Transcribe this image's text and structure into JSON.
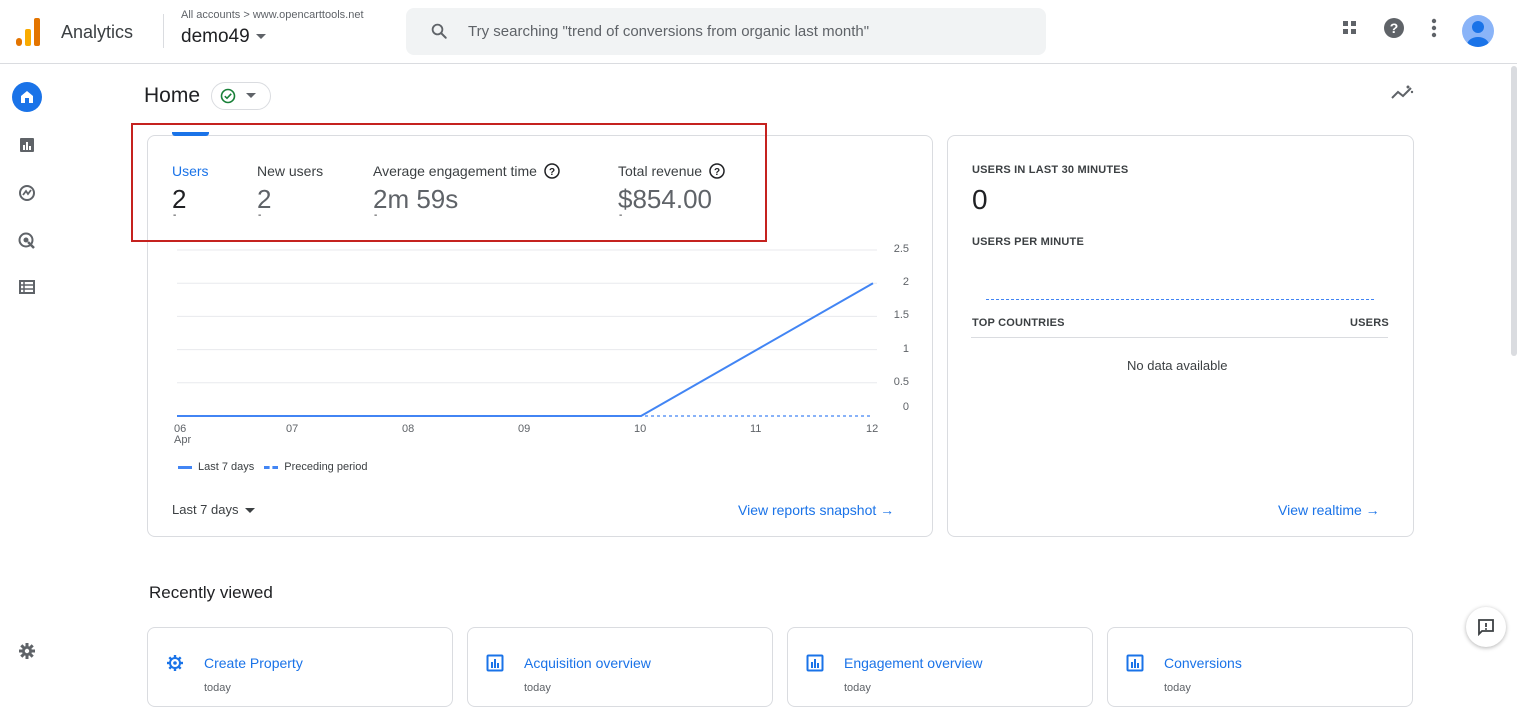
{
  "header": {
    "app_name": "Analytics",
    "breadcrumb": "All accounts > www.opencarttools.net",
    "account_name": "demo49",
    "search_placeholder": "Try searching \"trend of conversions from organic last month\""
  },
  "colors": {
    "accent": "#1a73e8",
    "series": "#4285f4",
    "highlight": "#c5221f",
    "logo_orange": "#f9ab00",
    "logo_dark_orange": "#e37400"
  },
  "icons": [
    "apps-icon",
    "help-icon",
    "more-vert-icon",
    "avatar-icon",
    "home-icon",
    "reports-icon",
    "explore-icon",
    "advertising-icon",
    "configure-icon",
    "settings-icon",
    "insights-icon",
    "feedback-icon"
  ],
  "main": {
    "title": "Home",
    "metrics": [
      {
        "label": "Users",
        "value": "2",
        "change": "-"
      },
      {
        "label": "New users",
        "value": "2",
        "change": "-"
      },
      {
        "label": "Average engagement time",
        "value": "2m 59s",
        "change": "-"
      },
      {
        "label": "Total revenue",
        "value": "$854.00",
        "change": "-"
      }
    ],
    "legend": {
      "current": "Last 7 days",
      "previous": "Preceding period"
    },
    "date_range": "Last 7 days",
    "snapshot_link": "View reports snapshot →"
  },
  "chart_data": {
    "type": "line",
    "x": [
      "06",
      "07",
      "08",
      "09",
      "10",
      "11",
      "12"
    ],
    "x_sublabel": "Apr",
    "y_ticks": [
      "0",
      "0.5",
      "1",
      "1.5",
      "2",
      "2.5"
    ],
    "ylim": [
      0,
      2.5
    ],
    "grid": true,
    "legend_position": "bottom-left",
    "series": [
      {
        "name": "Last 7 days",
        "values": [
          0,
          0,
          0,
          0,
          0,
          1,
          2
        ],
        "style": "solid"
      },
      {
        "name": "Preceding period",
        "values": [
          0,
          0,
          0,
          0,
          0,
          0,
          0
        ],
        "style": "dashed"
      }
    ]
  },
  "realtime": {
    "title": "USERS IN LAST 30 MINUTES",
    "value": "0",
    "per_minute_label": "USERS PER MINUTE",
    "countries_header": "TOP COUNTRIES",
    "users_header": "USERS",
    "empty_text": "No data available",
    "link": "View realtime →"
  },
  "recent": {
    "title": "Recently viewed",
    "items": [
      {
        "title": "Create Property",
        "sub": "today",
        "icon": "settings-icon"
      },
      {
        "title": "Acquisition overview",
        "sub": "today",
        "icon": "report-icon"
      },
      {
        "title": "Engagement overview",
        "sub": "today",
        "icon": "report-icon"
      },
      {
        "title": "Conversions",
        "sub": "today",
        "icon": "report-icon"
      }
    ]
  }
}
